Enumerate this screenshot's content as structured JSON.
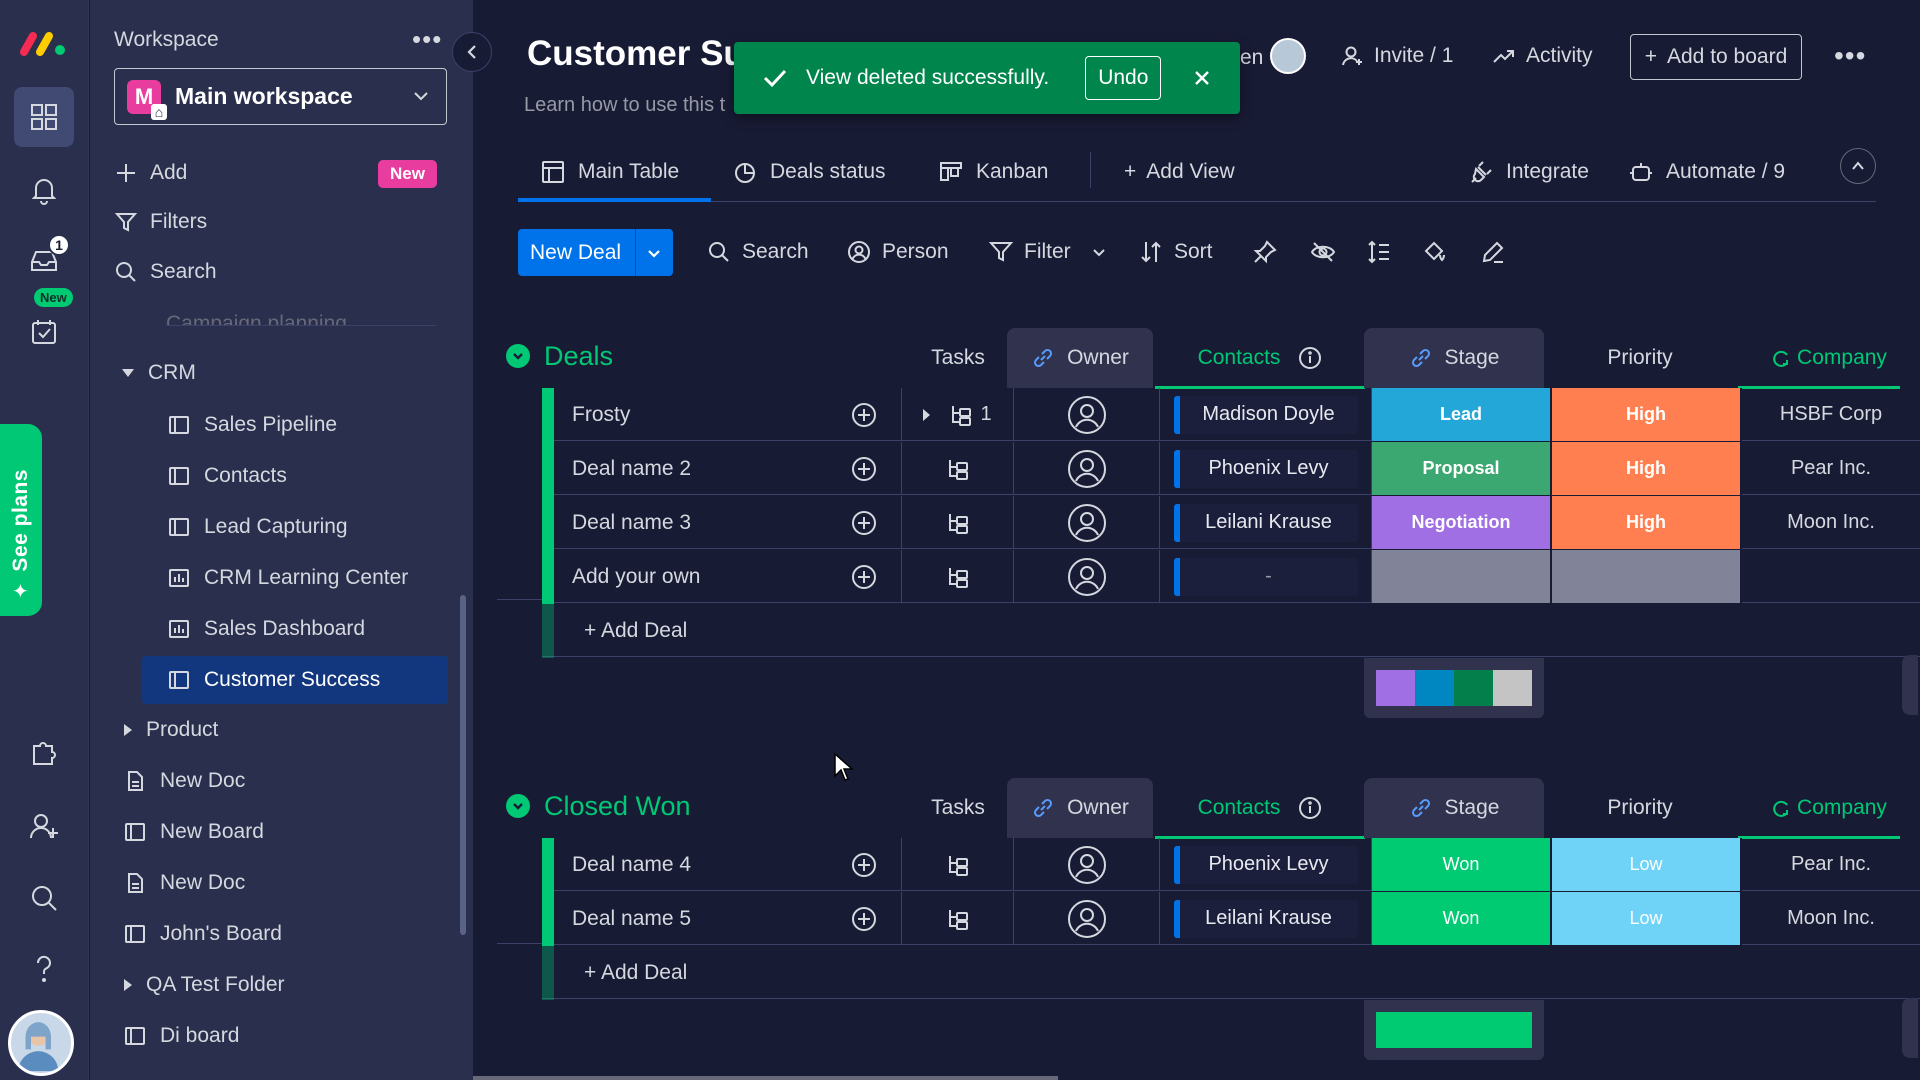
{
  "colors": {
    "accent": "#0073ea",
    "green": "#00c875",
    "won": "#00ca72",
    "lead": "#22a7d8",
    "proposal": "#3aa870",
    "negotiation": "#9f6fe3",
    "high": "#ff7f50",
    "low": "#6fd3f7",
    "empty": "#818499"
  },
  "rail": {
    "inbox_badge": "1",
    "new_badge": "New",
    "see_plans": "See plans"
  },
  "sidebar": {
    "workspace_label": "Workspace",
    "workspace_logo": "M",
    "workspace_name": "Main workspace",
    "add": "Add",
    "new_pill": "New",
    "filters": "Filters",
    "search": "Search",
    "faded_item": "Campaign planning",
    "folder_crm": "CRM",
    "crm_items": [
      "Sales Pipeline",
      "Contacts",
      "Lead Capturing",
      "CRM Learning Center",
      "Sales Dashboard",
      "Customer Success"
    ],
    "folder_product": "Product",
    "items": [
      "New Doc",
      "New Board",
      "New Doc",
      "John's Board"
    ],
    "folder_qa": "QA Test Folder",
    "last_item": "Di board"
  },
  "header": {
    "title": "Customer Su",
    "subtitle": "Learn how to use this t",
    "partial_name": "en",
    "invite": "Invite / 1",
    "activity": "Activity",
    "add_to_board": "Add to board"
  },
  "toast": {
    "message": "View deleted successfully.",
    "undo": "Undo"
  },
  "tabs": {
    "main_table": "Main Table",
    "deals_status": "Deals status",
    "kanban": "Kanban",
    "add_view": "Add View",
    "integrate": "Integrate",
    "automate": "Automate / 9"
  },
  "toolbar": {
    "new_deal": "New Deal",
    "search": "Search",
    "person": "Person",
    "filter": "Filter",
    "sort": "Sort"
  },
  "columns": {
    "tasks": "Tasks",
    "owner": "Owner",
    "contacts": "Contacts",
    "stage": "Stage",
    "priority": "Priority",
    "company": "Company"
  },
  "groups": [
    {
      "title": "Deals",
      "add_label": "+ Add Deal",
      "rows": [
        {
          "name": "Frosty",
          "tasks": "1",
          "contact": "Madison Doyle",
          "stage": "Lead",
          "priority": "High",
          "company": "HSBF Corp"
        },
        {
          "name": "Deal name 2",
          "tasks": "",
          "contact": "Phoenix Levy",
          "stage": "Proposal",
          "priority": "High",
          "company": "Pear Inc."
        },
        {
          "name": "Deal name 3",
          "tasks": "",
          "contact": "Leilani Krause",
          "stage": "Negotiation",
          "priority": "High",
          "company": "Moon Inc."
        },
        {
          "name": "Add your own",
          "tasks": "",
          "contact": "-",
          "stage": "",
          "priority": "",
          "company": ""
        }
      ]
    },
    {
      "title": "Closed Won",
      "add_label": "+ Add Deal",
      "rows": [
        {
          "name": "Deal name 4",
          "tasks": "",
          "contact": "Phoenix Levy",
          "stage": "Won",
          "priority": "Low",
          "company": "Pear Inc."
        },
        {
          "name": "Deal name 5",
          "tasks": "",
          "contact": "Leilani Krause",
          "stage": "Won",
          "priority": "Low",
          "company": "Moon Inc."
        }
      ]
    }
  ]
}
